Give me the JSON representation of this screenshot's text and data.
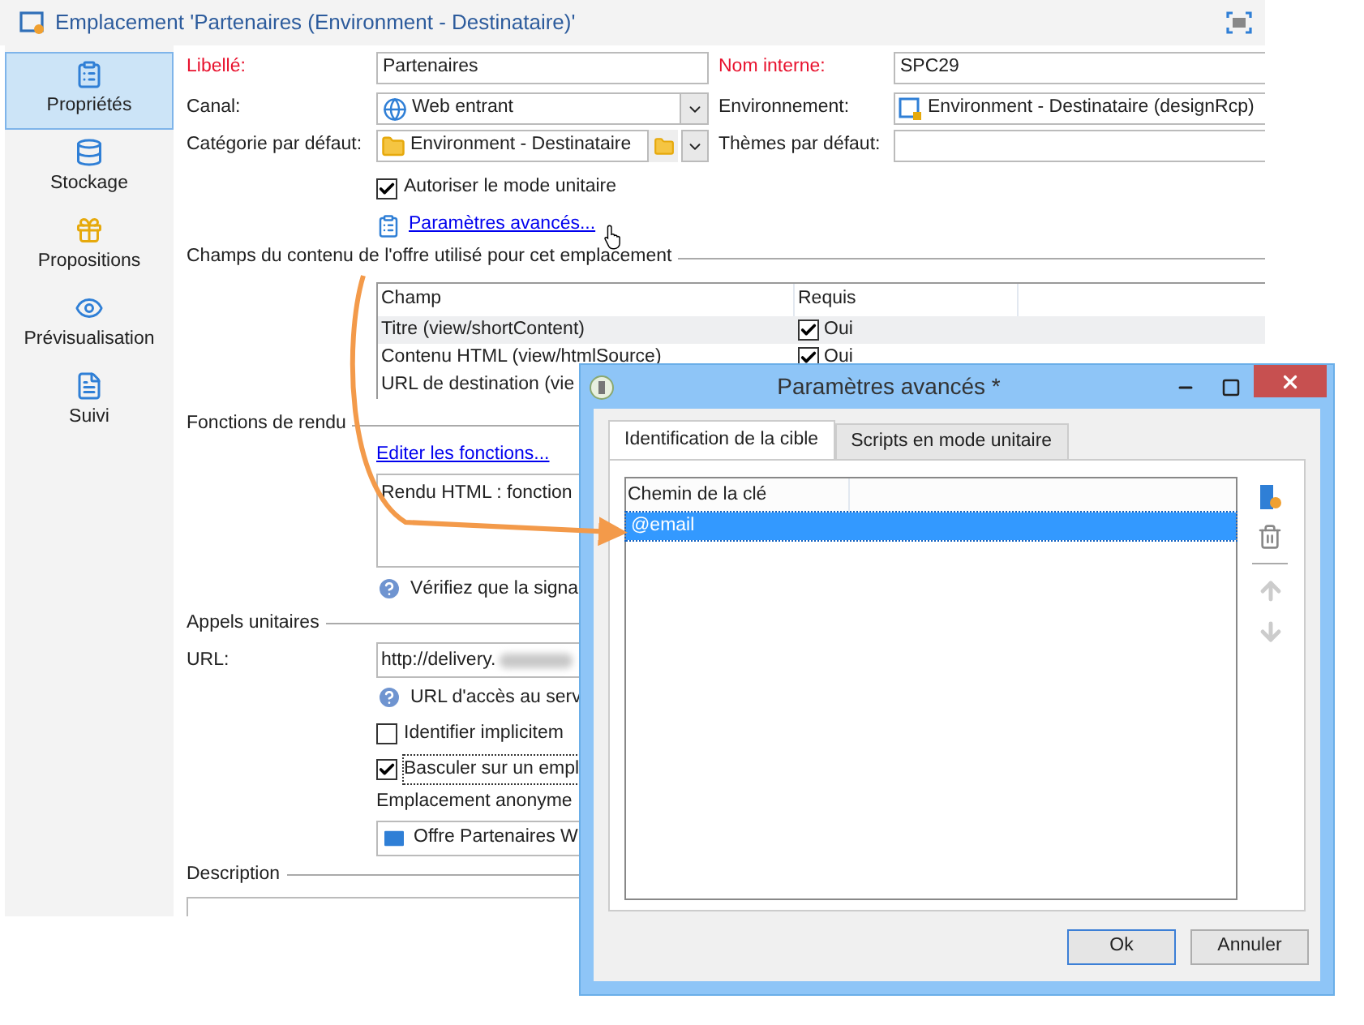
{
  "window": {
    "title": "Emplacement 'Partenaires (Environment - Destinataire)'"
  },
  "sidebar": {
    "items": [
      {
        "label": "Propriétés",
        "selected": true
      },
      {
        "label": "Stockage",
        "selected": false
      },
      {
        "label": "Propositions",
        "selected": false
      },
      {
        "label": "Prévisualisation",
        "selected": false
      },
      {
        "label": "Suivi",
        "selected": false
      }
    ]
  },
  "form": {
    "libelle": {
      "label": "Libellé:",
      "value": "Partenaires",
      "required": true
    },
    "nom_interne": {
      "label": "Nom interne:",
      "value": "SPC29",
      "required": true
    },
    "canal": {
      "label": "Canal:",
      "value": "Web entrant",
      "required": false
    },
    "environnement": {
      "label": "Environnement:",
      "value": "Environment - Destinataire (designRcp)",
      "required": false
    },
    "categorie": {
      "label": "Catégorie par défaut:",
      "value": "Environment - Destinataire",
      "required": false
    },
    "themes": {
      "label": "Thèmes par défaut:",
      "required": false
    },
    "mode_unitaire": {
      "label": "Autoriser le mode unitaire",
      "checked": true
    },
    "advanced_link": "Paramètres avancés..."
  },
  "content_fields": {
    "title": "Champs du contenu de l'offre utilisé pour cet emplacement",
    "columns": [
      "Champ",
      "Requis"
    ],
    "rows": [
      {
        "champ": "Titre (view/shortContent)",
        "requis": "Oui",
        "checked": true,
        "selected": true
      },
      {
        "champ": "Contenu HTML (view/htmlSource)",
        "requis": "Oui",
        "checked": true,
        "selected": false
      },
      {
        "champ": "URL de destination (vie",
        "selected": false
      }
    ]
  },
  "rendering": {
    "title": "Fonctions de rendu",
    "link": "Editer les fonctions...",
    "value": "Rendu HTML : fonction",
    "hint": "Vérifiez que la signa"
  },
  "unitary_calls": {
    "title": "Appels unitaires",
    "url_label": "URL:",
    "url_value": "http://delivery.",
    "url_hint": "URL d'accès au serv",
    "checks": [
      {
        "label": "Identifier implicitem",
        "checked": false,
        "focused": false
      },
      {
        "label": "Basculer sur un empl",
        "checked": true,
        "focused": true
      }
    ],
    "anon_label": "Emplacement anonyme",
    "anon_value": "Offre Partenaires W"
  },
  "description": {
    "title": "Description"
  },
  "dialog": {
    "title": "Paramètres avancés *",
    "tabs": [
      {
        "label": "Identification de la cible",
        "selected": true
      },
      {
        "label": "Scripts en mode unitaire",
        "selected": false
      }
    ],
    "list": {
      "column": "Chemin de la clé",
      "rows": [
        {
          "value": "@email",
          "selected": true
        }
      ]
    },
    "buttons": [
      {
        "label": "Ok",
        "default": true
      },
      {
        "label": "Annuler",
        "default": false
      }
    ]
  }
}
